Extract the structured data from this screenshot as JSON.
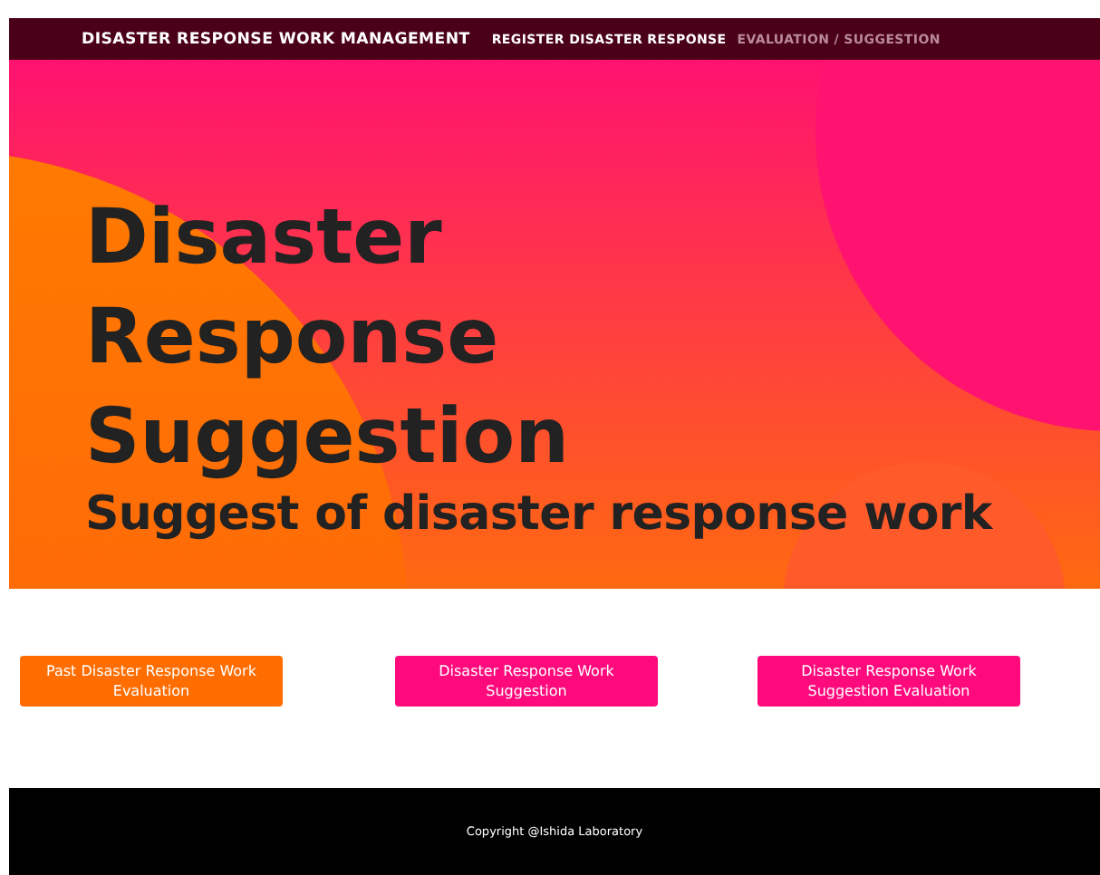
{
  "navbar": {
    "brand": "DISASTER RESPONSE WORK MANAGEMENT",
    "links": [
      {
        "label": "REGISTER DISASTER RESPONSE",
        "selected": true
      },
      {
        "label": "EVALUATION / SUGGESTION",
        "selected": false
      }
    ]
  },
  "hero": {
    "title": "Disaster Response Suggestion",
    "subtitle": "Suggest of disaster response work"
  },
  "buttons": [
    {
      "label": "Past Disaster Response Work Evaluation",
      "color": "#ff6d00"
    },
    {
      "label": "Disaster Response Work Suggestion",
      "color": "#ff0a7c"
    },
    {
      "label": "Disaster Response Work Suggestion Evaluation",
      "color": "#ff0a7c"
    }
  ],
  "footer": {
    "text": "Copyright @Ishida Laboratory"
  }
}
